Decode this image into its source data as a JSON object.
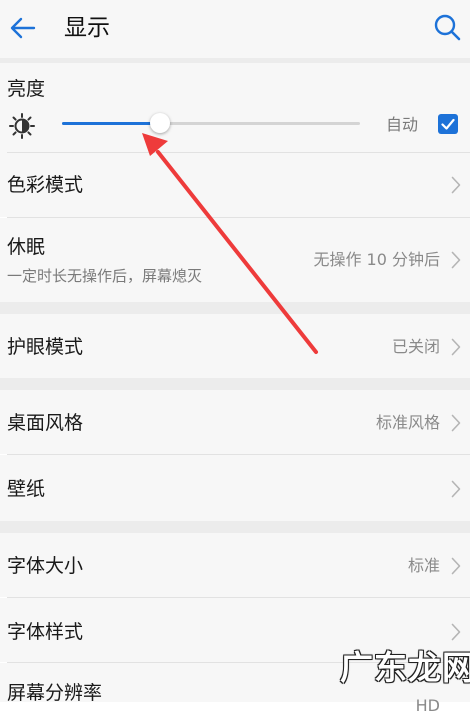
{
  "header": {
    "title": "显示",
    "back_icon": "arrow-left-icon",
    "search_icon": "search-icon"
  },
  "brightness": {
    "label": "亮度",
    "level_fraction": 0.33,
    "auto_label": "自动",
    "auto_checked": true
  },
  "rows": {
    "color_mode": {
      "label": "色彩模式"
    },
    "sleep": {
      "label": "休眠",
      "subtitle": "一定时长无操作后，屏幕熄灭",
      "value": "无操作 10 分钟后"
    },
    "eye_comfort": {
      "label": "护眼模式",
      "value": "已关闭"
    },
    "home_style": {
      "label": "桌面风格",
      "value": "标准风格"
    },
    "wallpaper": {
      "label": "壁纸"
    },
    "font_size": {
      "label": "字体大小",
      "value": "标准"
    },
    "font_style": {
      "label": "字体样式"
    },
    "resolution": {
      "label": "屏幕分辨率",
      "value": "HD"
    }
  },
  "watermark": "广东龙网",
  "colors": {
    "accent": "#1d72d8",
    "annotation": "#ee3b3b",
    "background": "#f7f7f7",
    "separator": "#ececec"
  }
}
